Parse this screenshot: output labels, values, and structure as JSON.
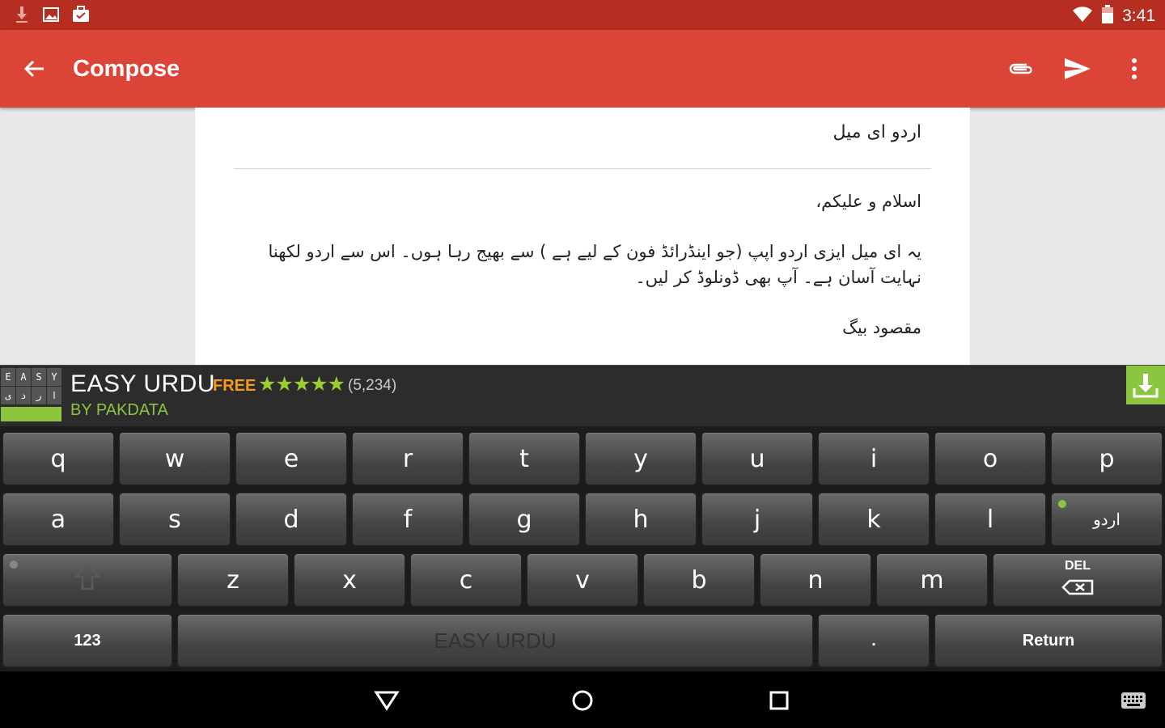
{
  "status_bar": {
    "time": "3:41",
    "left_icons": [
      "download-icon",
      "image-icon",
      "briefcase-check-icon"
    ],
    "right_icons": [
      "wifi-icon",
      "battery-icon"
    ]
  },
  "app_bar": {
    "title": "Compose",
    "color": "#db4437",
    "actions": [
      "attach-icon",
      "send-icon",
      "more-vert-icon"
    ]
  },
  "compose": {
    "subject": "اردو ای میل",
    "body": [
      "اسلام و علیکم،",
      "یہ ای میل ایزی اردو اپپ (جو اینڈرائڈ فون کے لیے ہے ) سے بھیج رہا ہوں۔ اس سے اردو لکھنا نہایت آسان ہے۔ آپ بھی ڈونلوڈ کر لیں۔",
      "مقصود بیگ"
    ]
  },
  "banner": {
    "logo_letters_top": [
      "E",
      "A",
      "S",
      "Y"
    ],
    "logo_letters_bottom": [
      "ی",
      "د",
      "ر",
      "ا"
    ],
    "name": "EASY URDU",
    "price": "FREE",
    "stars": "★★★★★",
    "rating_count": "(5,234)",
    "publisher": "BY PAKDATA",
    "accent": "#8cc63f"
  },
  "keyboard": {
    "row1": [
      "q",
      "w",
      "e",
      "r",
      "t",
      "y",
      "u",
      "i",
      "o",
      "p"
    ],
    "row2": [
      "a",
      "s",
      "d",
      "f",
      "g",
      "h",
      "j",
      "k",
      "l"
    ],
    "lang_key": "اردو",
    "row3": [
      "z",
      "x",
      "c",
      "v",
      "b",
      "n",
      "m"
    ],
    "del_label": "DEL",
    "numbers_key": "123",
    "space_label": "EASY URDU",
    "period_key": ".",
    "return_key": "Return"
  },
  "nav_bar": {
    "buttons": [
      "back-triangle-icon",
      "home-circle-icon",
      "recents-square-icon",
      "keyboard-icon"
    ]
  }
}
